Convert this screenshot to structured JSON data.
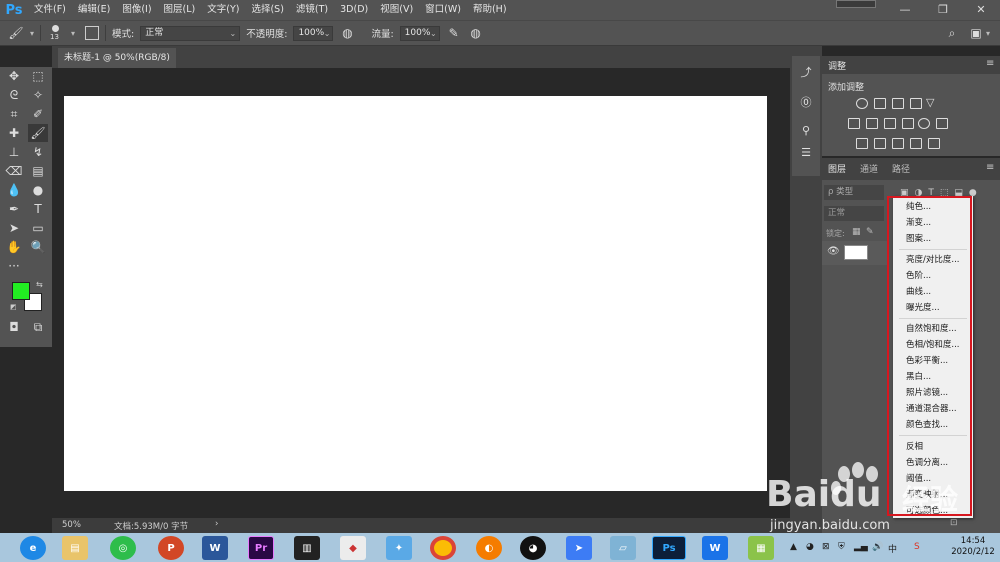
{
  "app": {
    "logo": "Ps"
  },
  "menu": [
    "文件(F)",
    "编辑(E)",
    "图像(I)",
    "图层(L)",
    "文字(Y)",
    "选择(S)",
    "滤镜(T)",
    "3D(D)",
    "视图(V)",
    "窗口(W)",
    "帮助(H)"
  ],
  "window_controls": {
    "minimize": "—",
    "restore": "❐",
    "close": "✕"
  },
  "options": {
    "brush_size": "13",
    "mode_label": "模式:",
    "mode_value": "正常",
    "opacity_label": "不透明度:",
    "opacity_value": "100%",
    "flow_label": "流量:",
    "flow_value": "100%"
  },
  "document": {
    "tab_title": "未标题-1 @ 50%(RGB/8)",
    "close": "×",
    "zoom": "50%",
    "doc_info": "文档:5.93M/0 字节",
    "arrow": "›"
  },
  "colors": {
    "foreground": "#22ee22",
    "background": "#ffffff",
    "accent": "#31a8ff",
    "highlight": "#d7171f"
  },
  "adjustments": {
    "title": "调整",
    "add_label": "添加调整"
  },
  "layers": {
    "tabs": [
      "图层",
      "通道",
      "路径"
    ],
    "filter_label": "ρ 类型",
    "blend_mode": "正常",
    "lock_label": "锁定:"
  },
  "context_menu": {
    "group1": [
      "纯色...",
      "渐变...",
      "图案..."
    ],
    "group2": [
      "亮度/对比度...",
      "色阶...",
      "曲线...",
      "曝光度..."
    ],
    "group3": [
      "自然饱和度...",
      "色相/饱和度...",
      "色彩平衡...",
      "黑白...",
      "照片滤镜...",
      "通道混合器...",
      "颜色查找..."
    ],
    "group4": [
      "反相",
      "色调分离...",
      "阈值...",
      "渐变映射...",
      "可选颜色..."
    ]
  },
  "taskbar": {
    "apps": [
      "browser",
      "explorer",
      "wechat",
      "powerpoint",
      "word",
      "premiere",
      "video",
      "winrar",
      "app",
      "chrome",
      "photos",
      "qq",
      "feishu",
      "notes",
      "photoshop",
      "wps",
      "notepad"
    ],
    "time": "14:54",
    "date": "2020/2/12",
    "ime": "中"
  },
  "watermark": {
    "brand": "Baidu",
    "cn": "经验",
    "url": "jingyan.baidu.com"
  }
}
